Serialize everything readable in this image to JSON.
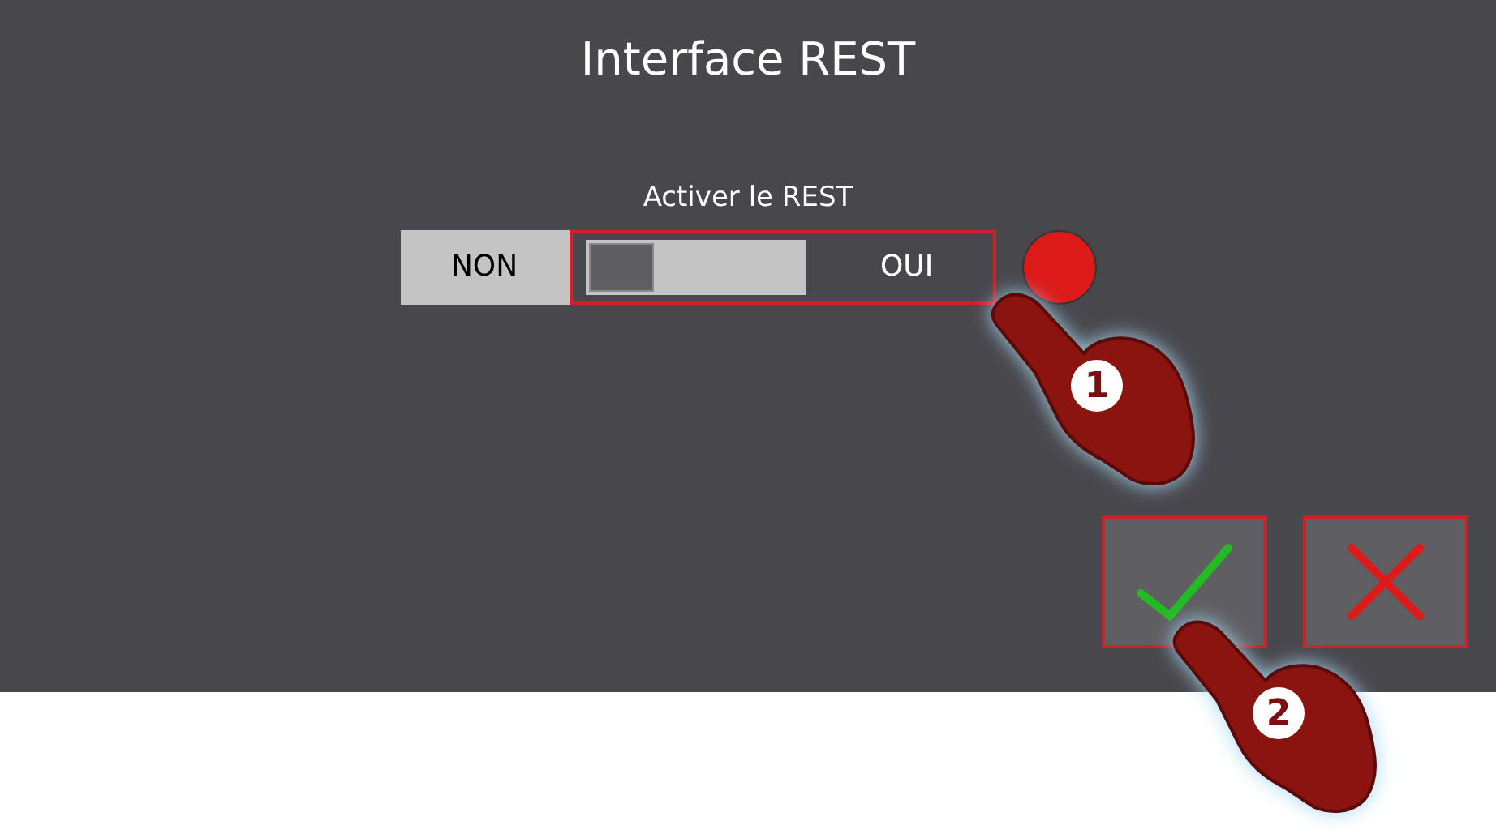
{
  "title": "Interface REST",
  "setting": {
    "label": "Activer le REST",
    "off_label": "NON",
    "on_label": "OUI",
    "on": false,
    "highlighted": true,
    "indicator": {
      "color": "#dd1a1a"
    }
  },
  "buttons": [
    {
      "kind": "confirm",
      "highlighted": true
    },
    {
      "kind": "cancel",
      "highlighted": true
    }
  ],
  "steps": [
    {
      "label": "1"
    },
    {
      "label": "2"
    }
  ]
}
